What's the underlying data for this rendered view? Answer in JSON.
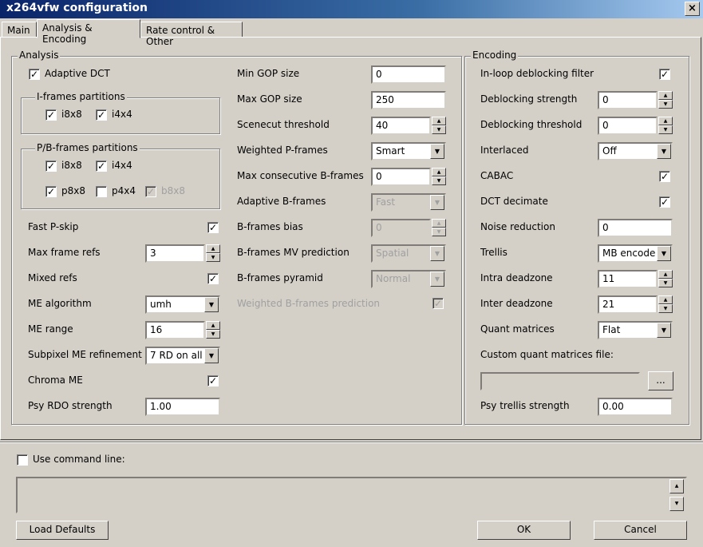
{
  "window": {
    "title": "x264vfw configuration",
    "close": "×"
  },
  "tabs": [
    {
      "label": "Main"
    },
    {
      "label": "Analysis & Encoding"
    },
    {
      "label": "Rate control & Other"
    }
  ],
  "analysis": {
    "title": "Analysis",
    "adaptive_dct": {
      "label": "Adaptive DCT",
      "checked": true
    },
    "iframes": {
      "title": "I-frames partitions",
      "i8x8": {
        "label": "i8x8",
        "checked": true
      },
      "i4x4": {
        "label": "i4x4",
        "checked": true
      }
    },
    "pbframes": {
      "title": "P/B-frames partitions",
      "i8x8": {
        "label": "i8x8",
        "checked": true
      },
      "i4x4": {
        "label": "i4x4",
        "checked": true
      },
      "p8x8": {
        "label": "p8x8",
        "checked": true
      },
      "p4x4": {
        "label": "p4x4",
        "checked": false
      },
      "b8x8": {
        "label": "b8x8",
        "checked": true
      }
    },
    "fast_pskip": {
      "label": "Fast P-skip",
      "checked": true
    },
    "max_frame_refs": {
      "label": "Max frame refs",
      "value": "3"
    },
    "mixed_refs": {
      "label": "Mixed refs",
      "checked": true
    },
    "me_algorithm": {
      "label": "ME algorithm",
      "value": "umh"
    },
    "me_range": {
      "label": "ME range",
      "value": "16"
    },
    "subpixel": {
      "label": "Subpixel ME refinement",
      "value": "7 RD on all"
    },
    "chroma_me": {
      "label": "Chroma ME",
      "checked": true
    },
    "psy_rdo": {
      "label": "Psy RDO strength",
      "value": "1.00"
    },
    "min_gop": {
      "label": "Min GOP size",
      "value": "0"
    },
    "max_gop": {
      "label": "Max GOP size",
      "value": "250"
    },
    "scenecut": {
      "label": "Scenecut threshold",
      "value": "40"
    },
    "weighted_p": {
      "label": "Weighted P-frames",
      "value": "Smart"
    },
    "max_bframes": {
      "label": "Max consecutive B-frames",
      "value": "0"
    },
    "adaptive_b": {
      "label": "Adaptive B-frames",
      "value": "Fast"
    },
    "bframes_bias": {
      "label": "B-frames bias",
      "value": "0"
    },
    "bframes_mv": {
      "label": "B-frames MV prediction",
      "value": "Spatial"
    },
    "bframes_pyramid": {
      "label": "B-frames pyramid",
      "value": "Normal"
    },
    "weighted_b": {
      "label": "Weighted B-frames prediction",
      "checked": true
    }
  },
  "encoding": {
    "title": "Encoding",
    "deblock": {
      "label": "In-loop deblocking filter",
      "checked": true
    },
    "deblock_strength": {
      "label": "Deblocking strength",
      "value": "0"
    },
    "deblock_threshold": {
      "label": "Deblocking threshold",
      "value": "0"
    },
    "interlaced": {
      "label": "Interlaced",
      "value": "Off"
    },
    "cabac": {
      "label": "CABAC",
      "checked": true
    },
    "dct_decimate": {
      "label": "DCT decimate",
      "checked": true
    },
    "noise_reduction": {
      "label": "Noise reduction",
      "value": "0"
    },
    "trellis": {
      "label": "Trellis",
      "value": "MB encode"
    },
    "intra_deadzone": {
      "label": "Intra deadzone",
      "value": "11"
    },
    "inter_deadzone": {
      "label": "Inter deadzone",
      "value": "21"
    },
    "quant_matrices": {
      "label": "Quant matrices",
      "value": "Flat"
    },
    "custom_quant": {
      "label": "Custom quant matrices file:",
      "value": "",
      "browse": "..."
    },
    "psy_trellis": {
      "label": "Psy trellis strength",
      "value": "0.00"
    }
  },
  "command_line": {
    "label": "Use command line:",
    "checked": false,
    "value": ""
  },
  "buttons": {
    "load_defaults": "Load Defaults",
    "ok": "OK",
    "cancel": "Cancel"
  }
}
